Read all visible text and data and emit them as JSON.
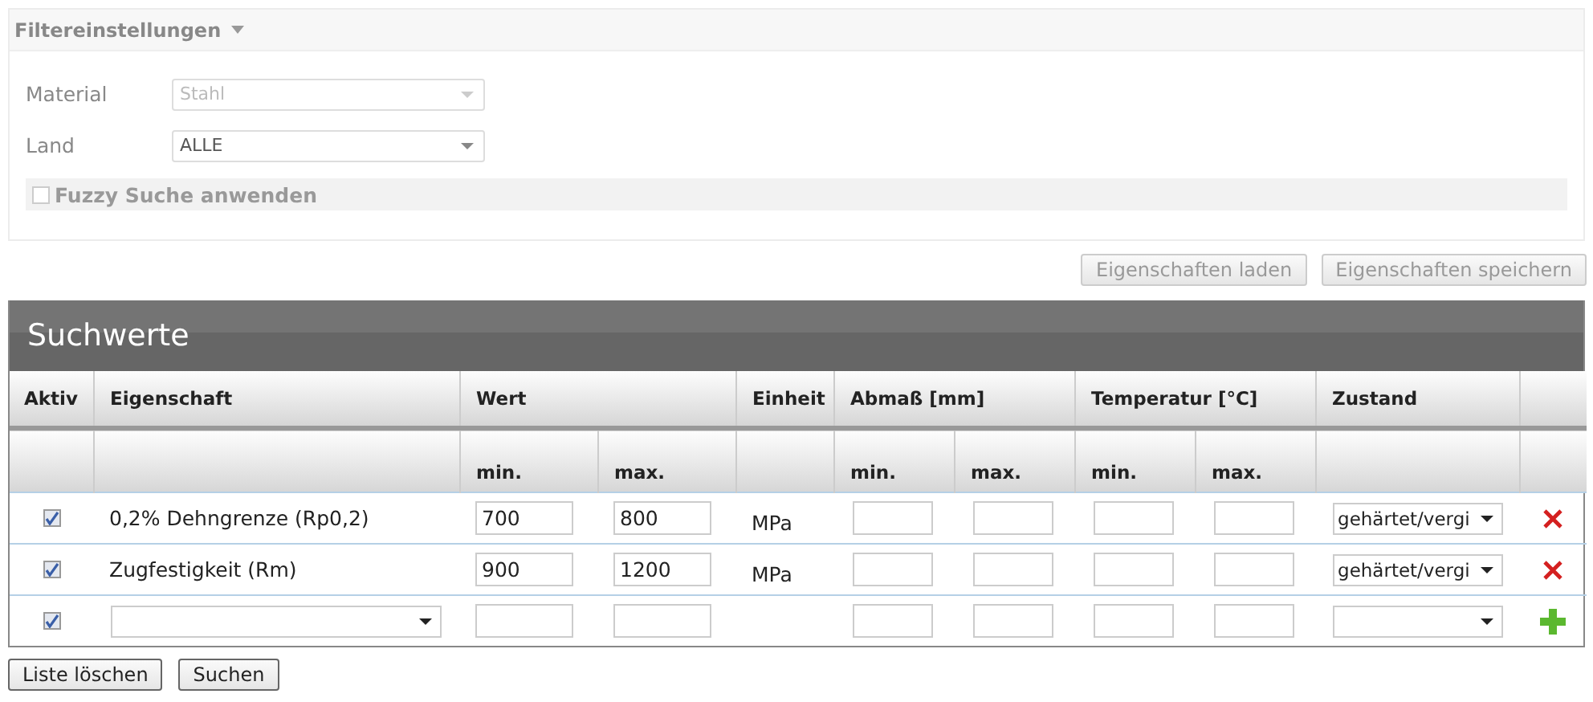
{
  "filter_panel": {
    "title": "Filtereinstellungen",
    "fields": [
      {
        "label": "Material",
        "value": "Stahl",
        "disabled": true
      },
      {
        "label": "Land",
        "value": "ALLE",
        "disabled": false
      }
    ],
    "fuzzy": {
      "label": "Fuzzy Suche anwenden",
      "checked": false,
      "disabled": true
    }
  },
  "property_buttons": [
    {
      "label": "Eigenschaften laden",
      "disabled": true
    },
    {
      "label": "Eigenschaften speichern",
      "disabled": true
    }
  ],
  "search_values": {
    "title": "Suchwerte",
    "columns": [
      {
        "label": "Aktiv"
      },
      {
        "label": "Eigenschaft"
      },
      {
        "label": "Wert",
        "sub": [
          "min.",
          "max."
        ]
      },
      {
        "label": "Einheit"
      },
      {
        "label": "Abmaß [mm]",
        "sub": [
          "min.",
          "max."
        ]
      },
      {
        "label": "Temperatur [°C]",
        "sub": [
          "min.",
          "max."
        ]
      },
      {
        "label": "Zustand"
      }
    ],
    "rows": [
      {
        "kind": "entry",
        "active": true,
        "property": "0,2% Dehngrenze (Rp0,2)",
        "value_min": "700",
        "value_max": "800",
        "unit": "MPa",
        "condition": "gehärtet/vergi"
      },
      {
        "kind": "entry",
        "active": true,
        "property": "Zugfestigkeit (Rm)",
        "value_min": "900",
        "value_max": "1200",
        "unit": "MPa",
        "condition": "gehärtet/vergi"
      },
      {
        "kind": "new",
        "active": true
      }
    ]
  },
  "bottom_buttons": [
    "Liste löschen",
    "Suchen"
  ]
}
